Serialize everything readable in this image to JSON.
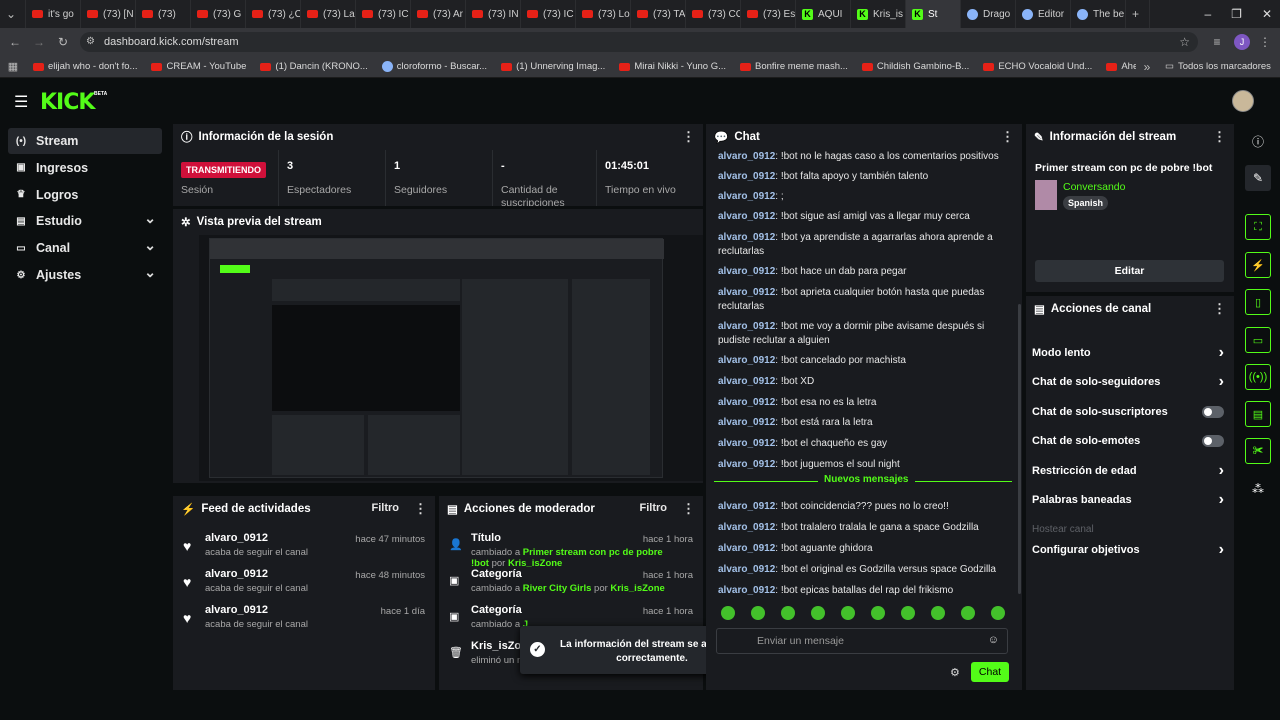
{
  "browser": {
    "tabs": [
      "it's go",
      "(73) [N",
      "(73)",
      "(73) G",
      "(73) ¿C",
      "(73) La",
      "(73) IC",
      "(73) Ar",
      "(73) IN",
      "(73) IC",
      "(73) Lo",
      "(73) TA",
      "(73) CO",
      "(73) Es",
      "AQUI",
      "Kris_is",
      "St",
      "Drago",
      "Editor",
      "The be"
    ],
    "url": "dashboard.kick.com/stream",
    "bookmarks": [
      "elijah who - don't fo...",
      "CREAM - YouTube",
      "(1) Dancin (KRONO...",
      "cloroformo - Buscar...",
      "(1) Unnerving Imag...",
      "Mirai Nikki - Yuno G...",
      "Bonfire meme mash...",
      "Childish Gambino-B...",
      "ECHO Vocaloid Und...",
      "Ahegao Meme - Yo..."
    ],
    "all_bookmarks": "Todos los marcadores",
    "profile_initial": "J"
  },
  "app": {
    "logo": "KICK",
    "logo_beta": "BETA",
    "sidebar": [
      {
        "label": "Stream",
        "icon": "broadcast-icon",
        "active": true
      },
      {
        "label": "Ingresos",
        "icon": "money-icon"
      },
      {
        "label": "Logros",
        "icon": "trophy-icon"
      },
      {
        "label": "Estudio",
        "icon": "studio-icon",
        "expand": true
      },
      {
        "label": "Canal",
        "icon": "channel-icon",
        "expand": true
      },
      {
        "label": "Ajustes",
        "icon": "gear-icon",
        "expand": true
      }
    ],
    "session": {
      "title": "Información de la sesión",
      "live_badge": "TRANSMITIENDO",
      "live_label": "Sesión",
      "stats": [
        {
          "value": "3",
          "label": "Espectadores"
        },
        {
          "value": "1",
          "label": "Seguidores"
        },
        {
          "value": "-",
          "label": "Cantidad de suscripciones"
        },
        {
          "value": "01:45:01",
          "label": "Tiempo en vivo"
        }
      ]
    },
    "preview": {
      "title": "Vista previa del stream"
    },
    "activity": {
      "title": "Feed de actividades",
      "filter": "Filtro",
      "items": [
        {
          "name": "alvaro_0912",
          "sub": "acaba de seguir el canal",
          "time": "hace 47 minutos"
        },
        {
          "name": "alvaro_0912",
          "sub": "acaba de seguir el canal",
          "time": "hace 48 minutos"
        },
        {
          "name": "alvaro_0912",
          "sub": "acaba de seguir el canal",
          "time": "hace 1 día"
        }
      ]
    },
    "modactions": {
      "title": "Acciones de moderador",
      "filter": "Filtro",
      "items": [
        {
          "title": "Título",
          "time": "hace 1 hora",
          "pre": "cambiado a ",
          "value": "Primer stream con pc de pobre !bot",
          "by": " por ",
          "user": "Kris_isZone"
        },
        {
          "title": "Categoría",
          "time": "hace 1 hora",
          "pre": "cambiado a ",
          "value": "River City Girls",
          "by": " por ",
          "user": "Kris_isZone"
        },
        {
          "title": "Categoría",
          "time": "hace 1 hora",
          "pre": "cambiado a ",
          "value": "J",
          "by": "",
          "user": ""
        },
        {
          "title": "Kris_isZone",
          "time": "",
          "pre": "eliminó un m",
          "value": "",
          "by": "",
          "user": ""
        }
      ]
    },
    "toast": "La información del stream se actualizó correctamente.",
    "chat": {
      "title": "Chat",
      "messages": [
        {
          "user": "alvaro_0912",
          "text": "!bot no le hagas caso a los comentarios positivos"
        },
        {
          "user": "alvaro_0912",
          "text": "!bot falta apoyo y también talento"
        },
        {
          "user": "alvaro_0912",
          "text": ";"
        },
        {
          "user": "alvaro_0912",
          "text": "!bot sigue así amigl vas a llegar muy cerca"
        },
        {
          "user": "alvaro_0912",
          "text": "!bot ya aprendiste a agarrarlas ahora aprende a reclutarlas"
        },
        {
          "user": "alvaro_0912",
          "text": "!bot hace un dab para pegar"
        },
        {
          "user": "alvaro_0912",
          "text": "!bot aprieta cualquier botón hasta que puedas reclutarlas"
        },
        {
          "user": "alvaro_0912",
          "text": "!bot me voy a dormir pibe avisame después si pudiste reclutar a alguien"
        },
        {
          "user": "alvaro_0912",
          "text": "!bot cancelado por machista"
        },
        {
          "user": "alvaro_0912",
          "text": "!bot XD"
        },
        {
          "user": "alvaro_0912",
          "text": "!bot esa no es la letra"
        },
        {
          "user": "alvaro_0912",
          "text": "!bot está rara la letra"
        },
        {
          "user": "alvaro_0912",
          "text": "!bot el chaqueño es gay"
        },
        {
          "user": "alvaro_0912",
          "text": "!bot juguemos el soul night"
        }
      ],
      "new_messages": "Nuevos mensajes",
      "new": [
        {
          "user": "alvaro_0912",
          "text": "!bot coincidencia??? pues no lo creo!!"
        },
        {
          "user": "alvaro_0912",
          "text": "!bot tralalero tralala le gana a space Godzilla"
        },
        {
          "user": "alvaro_0912",
          "text": "!bot aguante ghidora"
        },
        {
          "user": "alvaro_0912",
          "text": "!bot el original es Godzilla versus space Godzilla"
        },
        {
          "user": "alvaro_0912",
          "text": "!bot epicas batallas del rap del frikismo"
        }
      ],
      "placeholder": "Enviar un mensaje",
      "send": "Chat"
    },
    "streaminfo": {
      "title": "Información del stream",
      "stream_title": "Primer stream con pc de pobre !bot",
      "category": "Conversando",
      "language": "Spanish",
      "edit": "Editar"
    },
    "channel_actions": {
      "title": "Acciones de canal",
      "items": [
        {
          "label": "Modo lento",
          "kind": "chevron"
        },
        {
          "label": "Chat de solo-seguidores",
          "kind": "chevron"
        },
        {
          "label": "Chat de solo-suscriptores",
          "kind": "toggle"
        },
        {
          "label": "Chat de solo-emotes",
          "kind": "toggle"
        },
        {
          "label": "Restricción de edad",
          "kind": "chevron"
        },
        {
          "label": "Palabras baneadas",
          "kind": "chevron"
        },
        {
          "label": "Hostear canal",
          "kind": "disabled"
        },
        {
          "label": "Configurar objetivos",
          "kind": "chevron"
        }
      ]
    }
  }
}
